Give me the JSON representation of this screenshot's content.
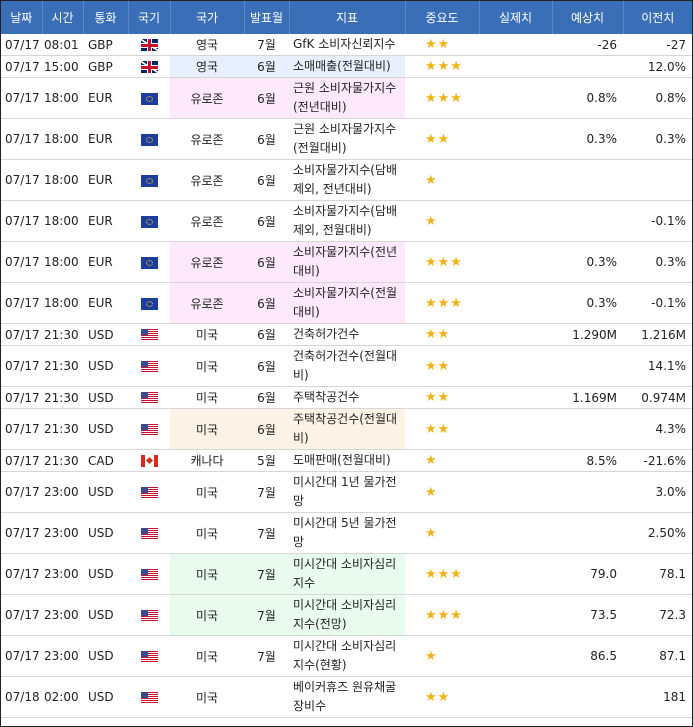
{
  "columns": [
    "날짜",
    "시간",
    "통화",
    "국기",
    "국가",
    "발표월",
    "지표",
    "중요도",
    "실제치",
    "예상치",
    "이전치"
  ],
  "rows": [
    {
      "date": "07/17",
      "time": "08:01",
      "currency": "GBP",
      "flag": "uk-flag-icon",
      "country": "영국",
      "period": "7월",
      "indicator": "GfK 소비자신뢰지수",
      "importance": "★★",
      "actual": "",
      "forecast": "-26",
      "previous": "-27",
      "highlight": "",
      "tall": false
    },
    {
      "date": "07/17",
      "time": "15:00",
      "currency": "GBP",
      "flag": "uk-flag-icon",
      "country": "영국",
      "period": "6월",
      "indicator": "소매매출(전월대비)",
      "importance": "★★★",
      "actual": "",
      "forecast": "",
      "previous": "12.0%",
      "highlight": "blue",
      "tall": false
    },
    {
      "date": "07/17",
      "time": "18:00",
      "currency": "EUR",
      "flag": "eu-flag-icon",
      "country": "유로존",
      "period": "6월",
      "indicator": "근원 소비자물가지수(전년대비)",
      "importance": "★★★",
      "actual": "",
      "forecast": "0.8%",
      "previous": "0.8%",
      "highlight": "pink",
      "tall": true
    },
    {
      "date": "07/17",
      "time": "18:00",
      "currency": "EUR",
      "flag": "eu-flag-icon",
      "country": "유로존",
      "period": "6월",
      "indicator": "근원 소비자물가지수(전월대비)",
      "importance": "★★",
      "actual": "",
      "forecast": "0.3%",
      "previous": "0.3%",
      "highlight": "",
      "tall": true
    },
    {
      "date": "07/17",
      "time": "18:00",
      "currency": "EUR",
      "flag": "eu-flag-icon",
      "country": "유로존",
      "period": "6월",
      "indicator": "소비자물가지수(담배제외, 전년대비)",
      "importance": "★",
      "actual": "",
      "forecast": "",
      "previous": "",
      "highlight": "",
      "tall": true
    },
    {
      "date": "07/17",
      "time": "18:00",
      "currency": "EUR",
      "flag": "eu-flag-icon",
      "country": "유로존",
      "period": "6월",
      "indicator": "소비자물가지수(담배제외, 전월대비)",
      "importance": "★",
      "actual": "",
      "forecast": "",
      "previous": "-0.1%",
      "highlight": "",
      "tall": true
    },
    {
      "date": "07/17",
      "time": "18:00",
      "currency": "EUR",
      "flag": "eu-flag-icon",
      "country": "유로존",
      "period": "6월",
      "indicator": "소비자물가지수(전년대비)",
      "importance": "★★★",
      "actual": "",
      "forecast": "0.3%",
      "previous": "0.3%",
      "highlight": "pink",
      "tall": true
    },
    {
      "date": "07/17",
      "time": "18:00",
      "currency": "EUR",
      "flag": "eu-flag-icon",
      "country": "유로존",
      "period": "6월",
      "indicator": "소비자물가지수(전월대비)",
      "importance": "★★★",
      "actual": "",
      "forecast": "0.3%",
      "previous": "-0.1%",
      "highlight": "pink",
      "tall": true
    },
    {
      "date": "07/17",
      "time": "21:30",
      "currency": "USD",
      "flag": "us-flag-icon",
      "country": "미국",
      "period": "6월",
      "indicator": "건축허가건수",
      "importance": "★★",
      "actual": "",
      "forecast": "1.290M",
      "previous": "1.216M",
      "highlight": "",
      "tall": false
    },
    {
      "date": "07/17",
      "time": "21:30",
      "currency": "USD",
      "flag": "us-flag-icon",
      "country": "미국",
      "period": "6월",
      "indicator": "건축허가건수(전월대비)",
      "importance": "★★",
      "actual": "",
      "forecast": "",
      "previous": "14.1%",
      "highlight": "",
      "tall": true
    },
    {
      "date": "07/17",
      "time": "21:30",
      "currency": "USD",
      "flag": "us-flag-icon",
      "country": "미국",
      "period": "6월",
      "indicator": "주택착공건수",
      "importance": "★★",
      "actual": "",
      "forecast": "1.169M",
      "previous": "0.974M",
      "highlight": "",
      "tall": false
    },
    {
      "date": "07/17",
      "time": "21:30",
      "currency": "USD",
      "flag": "us-flag-icon",
      "country": "미국",
      "period": "6월",
      "indicator": "주택착공건수(전월대비)",
      "importance": "★★",
      "actual": "",
      "forecast": "",
      "previous": "4.3%",
      "highlight": "peach",
      "tall": true
    },
    {
      "date": "07/17",
      "time": "21:30",
      "currency": "CAD",
      "flag": "canada-flag-icon",
      "country": "캐나다",
      "period": "5월",
      "indicator": "도매판매(전월대비)",
      "importance": "★",
      "actual": "",
      "forecast": "8.5%",
      "previous": "-21.6%",
      "highlight": "",
      "tall": false
    },
    {
      "date": "07/17",
      "time": "23:00",
      "currency": "USD",
      "flag": "us-flag-icon",
      "country": "미국",
      "period": "7월",
      "indicator": "미시간대 1년 물가전망",
      "importance": "★",
      "actual": "",
      "forecast": "",
      "previous": "3.0%",
      "highlight": "",
      "tall": true
    },
    {
      "date": "07/17",
      "time": "23:00",
      "currency": "USD",
      "flag": "us-flag-icon",
      "country": "미국",
      "period": "7월",
      "indicator": "미시간대 5년 물가전망",
      "importance": "★",
      "actual": "",
      "forecast": "",
      "previous": "2.50%",
      "highlight": "",
      "tall": true
    },
    {
      "date": "07/17",
      "time": "23:00",
      "currency": "USD",
      "flag": "us-flag-icon",
      "country": "미국",
      "period": "7월",
      "indicator": "미시간대 소비자심리지수",
      "importance": "★★★",
      "actual": "",
      "forecast": "79.0",
      "previous": "78.1",
      "highlight": "green",
      "tall": true
    },
    {
      "date": "07/17",
      "time": "23:00",
      "currency": "USD",
      "flag": "us-flag-icon",
      "country": "미국",
      "period": "7월",
      "indicator": "미시간대 소비자심리지수(전망)",
      "importance": "★★★",
      "actual": "",
      "forecast": "73.5",
      "previous": "72.3",
      "highlight": "green",
      "tall": true
    },
    {
      "date": "07/17",
      "time": "23:00",
      "currency": "USD",
      "flag": "us-flag-icon",
      "country": "미국",
      "period": "7월",
      "indicator": "미시간대 소비자심리지수(현황)",
      "importance": "★",
      "actual": "",
      "forecast": "86.5",
      "previous": "87.1",
      "highlight": "",
      "tall": true
    },
    {
      "date": "07/18",
      "time": "02:00",
      "currency": "USD",
      "flag": "us-flag-icon",
      "country": "미국",
      "period": "",
      "indicator": "베이커휴즈 원유채굴장비수",
      "importance": "★★",
      "actual": "",
      "forecast": "",
      "previous": "181",
      "highlight": "",
      "tall": true
    }
  ],
  "colors": {
    "header": "#3a6fb7",
    "star": "#f2b313",
    "highlight_blue": "#e8efff",
    "highlight_pink": "#fde9fb",
    "highlight_peach": "#fdf2e6",
    "highlight_green": "#e9fbef"
  }
}
